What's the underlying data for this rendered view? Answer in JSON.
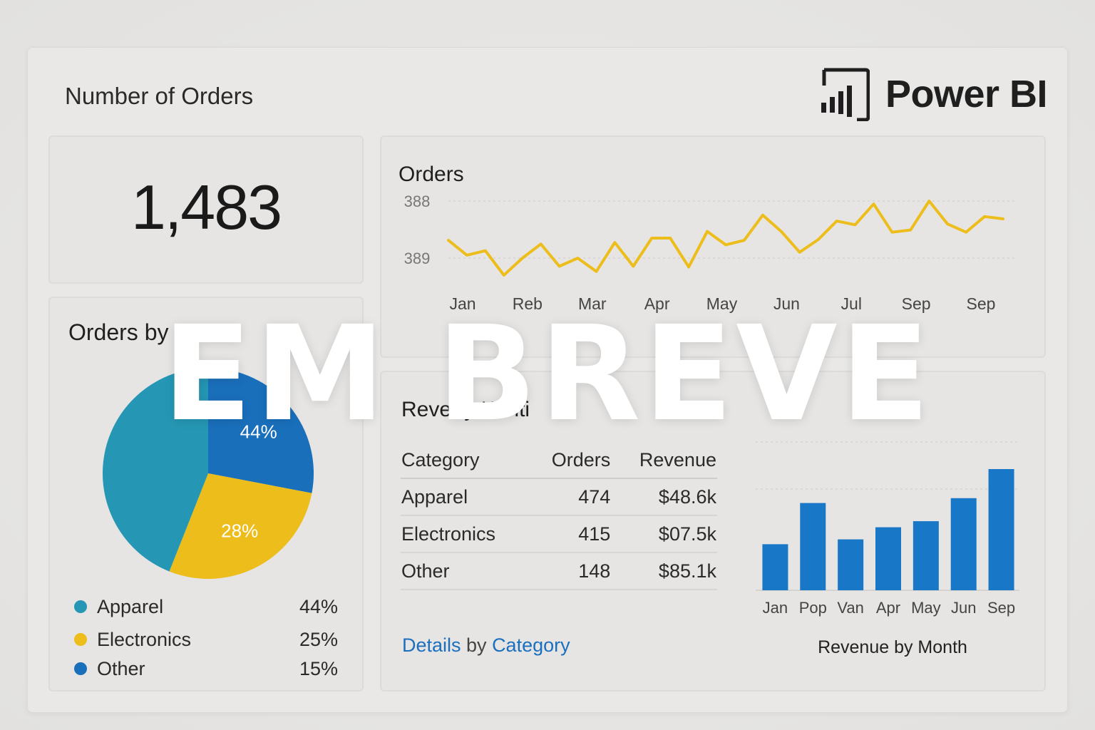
{
  "header": {
    "title": "Number of Orders",
    "brand_name": "Power BI"
  },
  "kpi": {
    "value": "1,483"
  },
  "colors": {
    "teal": "#2597b4",
    "yellow": "#ecbd1b",
    "blue": "#1a6fbb",
    "line": "#ecbd1b",
    "bar": "#1877c6"
  },
  "orders_card": {
    "title": "Orders"
  },
  "category_card": {
    "title": "Orders by Cates",
    "legend": [
      {
        "label": "Apparel",
        "value": "44%",
        "color": "#2597b4"
      },
      {
        "label": "Electronics",
        "value": "25%",
        "color": "#ecbd1b"
      },
      {
        "label": "Other",
        "value": "15%",
        "color": "#1a6fbb"
      }
    ]
  },
  "revenue_card": {
    "title": "Rever    y Konti",
    "table": {
      "headers": [
        "Category",
        "Orders",
        "Revenue"
      ],
      "rows": [
        [
          "Apparel",
          "474",
          "$48.6k"
        ],
        [
          "Electronics",
          "415",
          "$07.5k"
        ],
        [
          "Other",
          "148",
          "$85.1k"
        ]
      ]
    },
    "link_part1": "Details",
    "link_part2": " by ",
    "link_part3": "Category"
  },
  "overlay": {
    "text": "EM BREVE"
  },
  "chart_data": [
    {
      "type": "line",
      "title": "Orders",
      "y_tick_labels": [
        "388",
        "389"
      ],
      "x_tick_labels": [
        "Jan",
        "Reb",
        "Mar",
        "Apr",
        "May",
        "Jun",
        "Jul",
        "Sep",
        "Sep"
      ],
      "grid": true,
      "series": [
        {
          "values": [
            0.47,
            0.27,
            0.33,
            0.0,
            0.23,
            0.42,
            0.12,
            0.23,
            0.05,
            0.44,
            0.12,
            0.5,
            0.5,
            0.11,
            0.59,
            0.41,
            0.47,
            0.81,
            0.59,
            0.31,
            0.48,
            0.73,
            0.68,
            0.96,
            0.58,
            0.61,
            1.0,
            0.69,
            0.58,
            0.79,
            0.76
          ]
        }
      ]
    },
    {
      "type": "pie",
      "slices": [
        {
          "label": "Apparel",
          "value": 44,
          "color": "#2597b4",
          "data_label": ""
        },
        {
          "label": "Electronics",
          "value": 28,
          "color": "#ecbd1b",
          "data_label": "28%"
        },
        {
          "label": "Other",
          "value": 28,
          "color": "#1a6fbb",
          "data_label": "44%"
        }
      ]
    },
    {
      "type": "bar",
      "title": "Revenue by Month",
      "categories": [
        "Jan",
        "Pop",
        "Van",
        "Apr",
        "May",
        "Jun",
        "Sep"
      ],
      "values": [
        38,
        72,
        42,
        52,
        57,
        76,
        100
      ],
      "ylim": [
        0,
        100
      ],
      "grid": true
    }
  ]
}
